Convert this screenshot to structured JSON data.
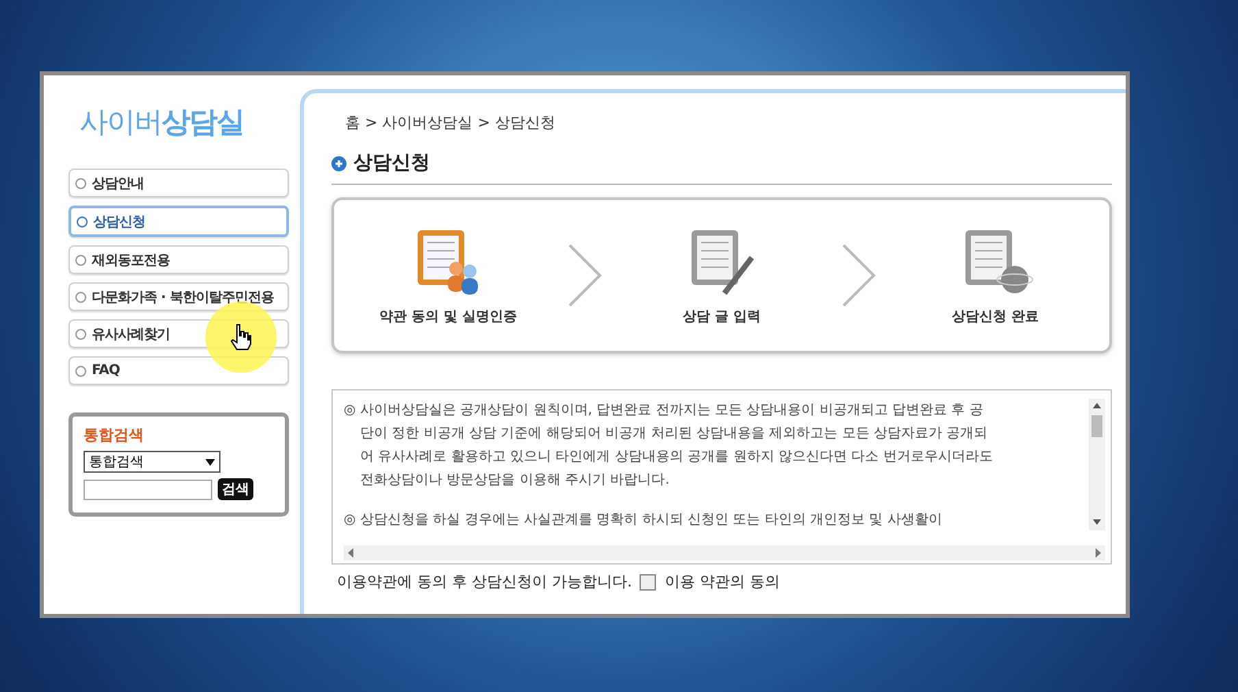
{
  "sidebar": {
    "logo": "사이버**상담실**",
    "items": [
      {
        "label": "상담안내",
        "selected": false
      },
      {
        "label": "상담신청",
        "selected": true
      },
      {
        "label": "재외동포전용",
        "selected": false
      },
      {
        "label": "다문화가족 · 북한이탈주민전용",
        "selected": false
      },
      {
        "label": "유사사례찾기",
        "selected": false
      },
      {
        "label": "FAQ",
        "selected": false
      }
    ],
    "search": {
      "title": "통합검색",
      "select_value": "통합검색",
      "button": "검색"
    }
  },
  "breadcrumb": "홈 > 사이버상담실 > 상담신청",
  "page_title": "상담신청",
  "steps": [
    {
      "kind": "agree",
      "label": "약관 동의 및 실명인증",
      "active": true
    },
    {
      "kind": "write",
      "label": "상담 글 입력",
      "active": false
    },
    {
      "kind": "done",
      "label": "상담신청 완료",
      "active": false
    }
  ],
  "terms": [
    "◎ 사이버상담실은 공개상담이 원칙이며, 답변완료 전까지는 모든 상담내용이 비공개되고 답변완료 후 공단이 정한 비공개 상담 기준에 해당되어 비공개 처리된 상담내용을 제외하고는 모든 상담자료가 공개되어 유사사례로 활용하고 있으니 타인에게 상담내용의 공개를 원하지 않으신다면 다소 번거로우시더라도 전화상담이나 방문상담을 이용해 주시기 바랍니다.",
    "◎ 상담신청을 하실 경우에는 사실관계를 명확히 하시되 신청인 또는 타인의 개인정보 및 사생활이"
  ],
  "agree": {
    "notice": "이용약관에 동의 후 상담신청이 가능합니다.",
    "checkbox_label": "이용 약관의 동의",
    "checked": false
  }
}
